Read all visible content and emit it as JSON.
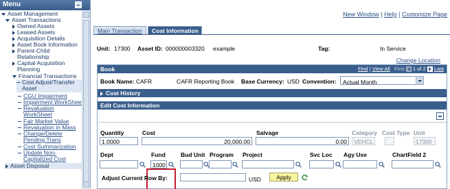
{
  "menu": {
    "title": "Menu",
    "items": [
      {
        "label": "Asset Management"
      },
      {
        "label": "Asset Transactions"
      },
      {
        "label": "Owned Assets"
      },
      {
        "label": "Leased Assets"
      },
      {
        "label": "Acquisition Details"
      },
      {
        "label": "Asset Book Information"
      },
      {
        "label": "Parent-Child"
      },
      {
        "label": "Relationship"
      },
      {
        "label": "Capital Acquisition"
      },
      {
        "label": "Planning"
      },
      {
        "label": "Financial Transactions"
      },
      {
        "label": "Cost Adjust/Transfer"
      },
      {
        "label": "Asset"
      },
      {
        "label": "CGU Impairment"
      },
      {
        "label": "Impairment WorkSheet"
      },
      {
        "label": "Revaluation"
      },
      {
        "label": "WorkSheet"
      },
      {
        "label": "Fair Market Value"
      },
      {
        "label": "Revaluation in Mass"
      },
      {
        "label": "Change/Delete"
      },
      {
        "label": "Pending Trans"
      },
      {
        "label": "Cost Summarization"
      },
      {
        "label": "Update Non-"
      },
      {
        "label": "Capitalized Cost"
      },
      {
        "label": "Asset Disposal"
      }
    ]
  },
  "header": {
    "new_window": "New Window",
    "sep1": "|",
    "help": "Help",
    "sep2": "|",
    "customize": "Customize Page"
  },
  "tabs": {
    "main": "Main Transaction",
    "cost_info": "Cost Information"
  },
  "asset": {
    "unit_label": "Unit:",
    "unit_value": "17300",
    "asset_id_label": "Asset ID:",
    "asset_id_value": "000000003320",
    "asset_desc": "example",
    "tag_label": "Tag:",
    "status": "In Service",
    "change_location": "Change Location"
  },
  "book": {
    "title": "Book",
    "nav": {
      "find": "Find",
      "view_all": "View All",
      "first": "First",
      "count": "1 of 2",
      "last": "Last"
    },
    "book_name_label": "Book Name:",
    "book_name_value": "CAFR",
    "book_desc": "CAFR Reporting Book",
    "base_currency_label": "Base Currency:",
    "base_currency_value": "USD",
    "convention_label": "Convention:",
    "convention_value": "Actual Month"
  },
  "cost_history": {
    "title": "Cost History"
  },
  "edit_cost": {
    "title": "Edit Cost Information",
    "quantity_label": "Quantity",
    "quantity_value": "1.0000",
    "cost_label": "Cost",
    "cost_value": "20,000.00",
    "salvage_label": "Salvage",
    "salvage_value": "0.00",
    "category_label": "Category",
    "category_value": "VEHCL",
    "cost_type_label": "Cost Type",
    "cost_type_value": "",
    "unit_label": "Unit",
    "unit_value": "17300",
    "dept_label": "Dept",
    "dept_value": "",
    "fund_label": "Fund",
    "fund_value": "1000",
    "bud_unit_label": "Bud Unit",
    "bud_unit_value": "",
    "program_label": "Program",
    "program_value": "",
    "project_label": "Project",
    "project_value": "",
    "svc_loc_label": "Svc Loc",
    "svc_loc_value": "",
    "agy_use_label": "Agy Use",
    "agy_use_value": "",
    "chartfield2_label": "ChartField 2",
    "chartfield2_value": "",
    "adjust_label": "Adjust Current Row By:",
    "adjust_value": "",
    "adjust_currency": "USD",
    "apply_label": "Apply"
  },
  "colors": {
    "header_bar": "#3a5e8c",
    "highlight_box": "#c0192a",
    "apply_button": "#f8f49b",
    "link": "#2a4f8a"
  }
}
